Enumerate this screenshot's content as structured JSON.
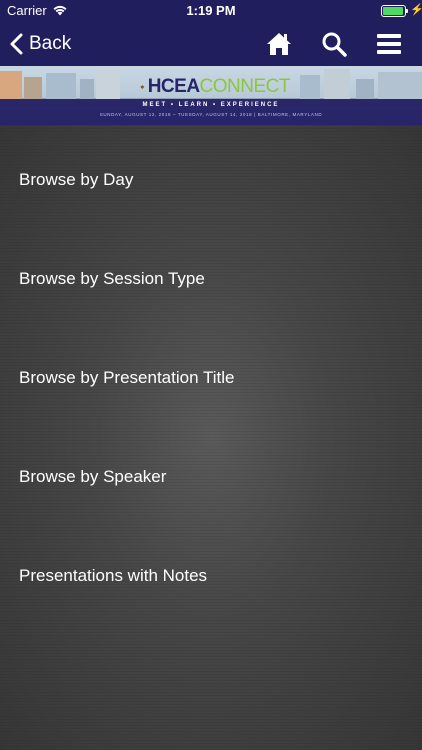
{
  "status_bar": {
    "carrier": "Carrier",
    "time": "1:19 PM"
  },
  "nav": {
    "back_label": "Back",
    "icons": [
      "home-icon",
      "search-icon",
      "menu-icon"
    ]
  },
  "banner": {
    "logo_part1": "HCEA",
    "logo_part2": "CONNECT",
    "tagline": "MEET • LEARN • EXPERIENCE",
    "dates": "SUNDAY, AUGUST 12, 2018 – TUESDAY, AUGUST 14, 2018 | BALTIMORE, MARYLAND"
  },
  "menu": {
    "items": [
      {
        "label": "Browse by Day"
      },
      {
        "label": "Browse by Session Type"
      },
      {
        "label": "Browse by Presentation Title"
      },
      {
        "label": "Browse by Speaker"
      },
      {
        "label": "Presentations with Notes"
      }
    ]
  },
  "colors": {
    "nav_background": "#201e5c",
    "battery": "#4cd964",
    "logo_primary": "#27246a",
    "logo_accent": "#8cc63f"
  }
}
